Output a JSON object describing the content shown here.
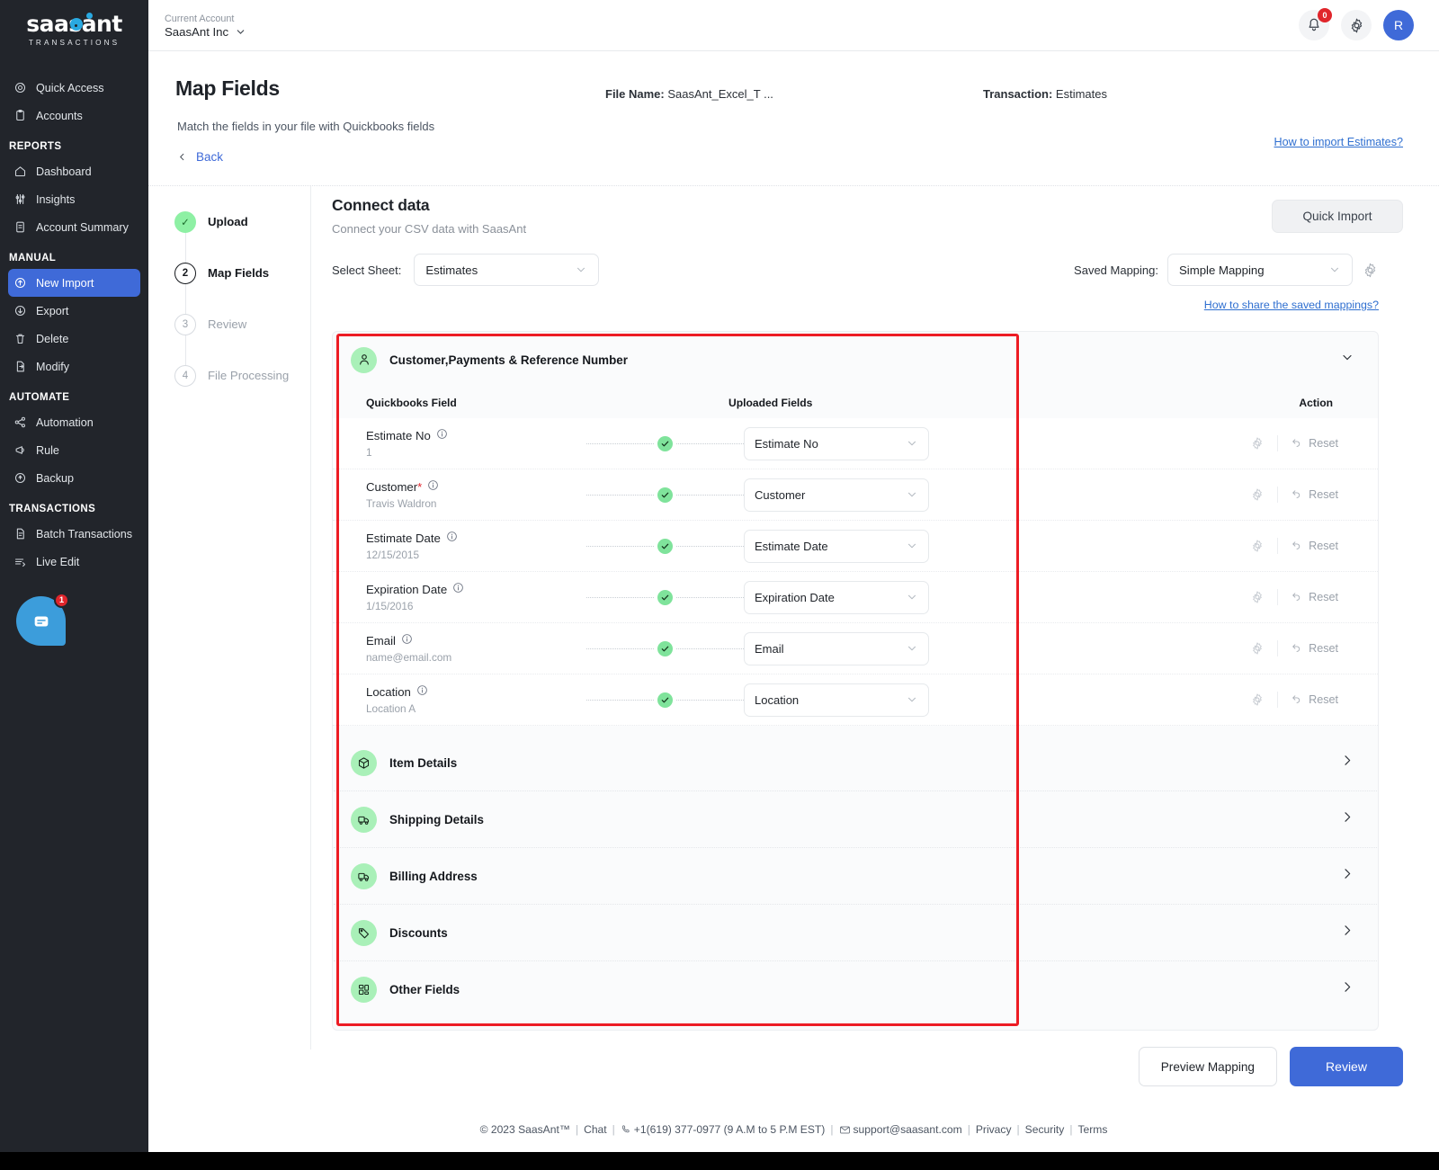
{
  "brand": {
    "logo_word": "saasant",
    "logo_sub": "TRANSACTIONS",
    "accent_blue": "#3f6ad8",
    "accent_green": "#8ef0a4",
    "alert_red": "#e0252b",
    "highlight_red": "#ed1c24"
  },
  "sidebar": {
    "groups": [
      {
        "label": "",
        "items": [
          {
            "label": "Quick Access",
            "icon": "target-icon",
            "active": false
          },
          {
            "label": "Accounts",
            "icon": "clipboard-icon",
            "active": false
          }
        ]
      },
      {
        "label": "REPORTS",
        "items": [
          {
            "label": "Dashboard",
            "icon": "home-icon",
            "active": false
          },
          {
            "label": "Insights",
            "icon": "sliders-icon",
            "active": false
          },
          {
            "label": "Account Summary",
            "icon": "document-icon",
            "active": false
          }
        ]
      },
      {
        "label": "MANUAL",
        "items": [
          {
            "label": "New Import",
            "icon": "upload-cloud-icon",
            "active": true
          },
          {
            "label": "Export",
            "icon": "download-cloud-icon",
            "active": false
          },
          {
            "label": "Delete",
            "icon": "trash-icon",
            "active": false
          },
          {
            "label": "Modify",
            "icon": "file-edit-icon",
            "active": false
          }
        ]
      },
      {
        "label": "AUTOMATE",
        "items": [
          {
            "label": "Automation",
            "icon": "share-nodes-icon",
            "active": false
          },
          {
            "label": "Rule",
            "icon": "megaphone-icon",
            "active": false
          },
          {
            "label": "Backup",
            "icon": "backup-cloud-icon",
            "active": false
          }
        ]
      },
      {
        "label": "TRANSACTIONS",
        "items": [
          {
            "label": "Batch Transactions",
            "icon": "file-icon",
            "active": false
          },
          {
            "label": "Live Edit",
            "icon": "live-edit-icon",
            "active": false
          }
        ]
      }
    ],
    "chat": {
      "icon": "chat-icon",
      "badge": "1"
    }
  },
  "topbar": {
    "account_label": "Current Account",
    "account_name": "SaasAnt Inc",
    "chevron_icon": "chevron-down-icon",
    "notification": {
      "icon": "bell-icon",
      "badge": "0"
    },
    "settings": {
      "icon": "gear-icon"
    },
    "avatar": {
      "initial": "R"
    }
  },
  "pagehead": {
    "title": "Map Fields",
    "subtitle": "Match the fields in your file with Quickbooks fields",
    "back_label": "Back",
    "back_icon": "chevron-left-icon",
    "file_name_label": "File Name:",
    "file_name_value": "SaasAnt_Excel_T ...",
    "transaction_label": "Transaction:",
    "transaction_value": "Estimates",
    "help_link": "How to import Estimates?"
  },
  "stepper": {
    "steps": [
      {
        "marker": "✓",
        "label": "Upload",
        "state": "done"
      },
      {
        "marker": "2",
        "label": "Map Fields",
        "state": "current"
      },
      {
        "marker": "3",
        "label": "Review",
        "state": "pending"
      },
      {
        "marker": "4",
        "label": "File Processing",
        "state": "pending"
      }
    ]
  },
  "connect": {
    "title": "Connect data",
    "subtitle": "Connect your CSV data with SaasAnt",
    "select_sheet_label": "Select Sheet:",
    "select_sheet_value": "Estimates",
    "saved_mapping_label": "Saved Mapping:",
    "saved_mapping_value": "Simple Mapping",
    "mapping_gear_icon": "gear-icon",
    "share_link": "How to share the saved mappings?",
    "quick_import_label": "Quick Import"
  },
  "mapping": {
    "section_title": "Customer,Payments & Reference Number",
    "section_icon": "user-icon",
    "expanded_chevron_icon": "chevron-down-icon",
    "columns": {
      "quickbooks_field": "Quickbooks Field",
      "uploaded_fields": "Uploaded Fields",
      "action": "Action"
    },
    "rows": [
      {
        "qb_field": "Estimate No",
        "required": false,
        "sample": "1",
        "status_icon": "check-icon",
        "uploaded_value": "Estimate No",
        "gear_icon": "gear-icon",
        "reset_label": "Reset",
        "reset_icon": "undo-icon"
      },
      {
        "qb_field": "Customer",
        "required": true,
        "sample": "Travis Waldron",
        "status_icon": "check-icon",
        "uploaded_value": "Customer",
        "gear_icon": "gear-icon",
        "reset_label": "Reset",
        "reset_icon": "undo-icon"
      },
      {
        "qb_field": "Estimate Date",
        "required": false,
        "sample": "12/15/2015",
        "status_icon": "check-icon",
        "uploaded_value": "Estimate Date",
        "gear_icon": "gear-icon",
        "reset_label": "Reset",
        "reset_icon": "undo-icon"
      },
      {
        "qb_field": "Expiration Date",
        "required": false,
        "sample": "1/15/2016",
        "status_icon": "check-icon",
        "uploaded_value": "Expiration Date",
        "gear_icon": "gear-icon",
        "reset_label": "Reset",
        "reset_icon": "undo-icon"
      },
      {
        "qb_field": "Email",
        "required": false,
        "sample": "name@email.com",
        "status_icon": "check-icon",
        "uploaded_value": "Email",
        "gear_icon": "gear-icon",
        "reset_label": "Reset",
        "reset_icon": "undo-icon"
      },
      {
        "qb_field": "Location",
        "required": false,
        "sample": "Location A",
        "status_icon": "check-icon",
        "uploaded_value": "Location",
        "gear_icon": "gear-icon",
        "reset_label": "Reset",
        "reset_icon": "undo-icon"
      }
    ],
    "collapsed_sections": [
      {
        "label": "Item Details",
        "icon": "box-icon",
        "chevron": "chevron-right-icon"
      },
      {
        "label": "Shipping Details",
        "icon": "truck-icon",
        "chevron": "chevron-right-icon"
      },
      {
        "label": "Billing Address",
        "icon": "truck-icon",
        "chevron": "chevron-right-icon"
      },
      {
        "label": "Discounts",
        "icon": "tag-icon",
        "chevron": "chevron-right-icon"
      },
      {
        "label": "Other Fields",
        "icon": "grid-icon",
        "chevron": "chevron-right-icon"
      }
    ]
  },
  "footer_actions": {
    "preview_label": "Preview Mapping",
    "review_label": "Review"
  },
  "footer": {
    "copyright": "© 2023 SaasAnt™",
    "chat": "Chat",
    "phone": "+1(619) 377-0977 (9 A.M to 5 P.M EST)",
    "phone_icon": "phone-icon",
    "email": "support@saasant.com",
    "email_icon": "mail-icon",
    "privacy": "Privacy",
    "security": "Security",
    "terms": "Terms"
  }
}
